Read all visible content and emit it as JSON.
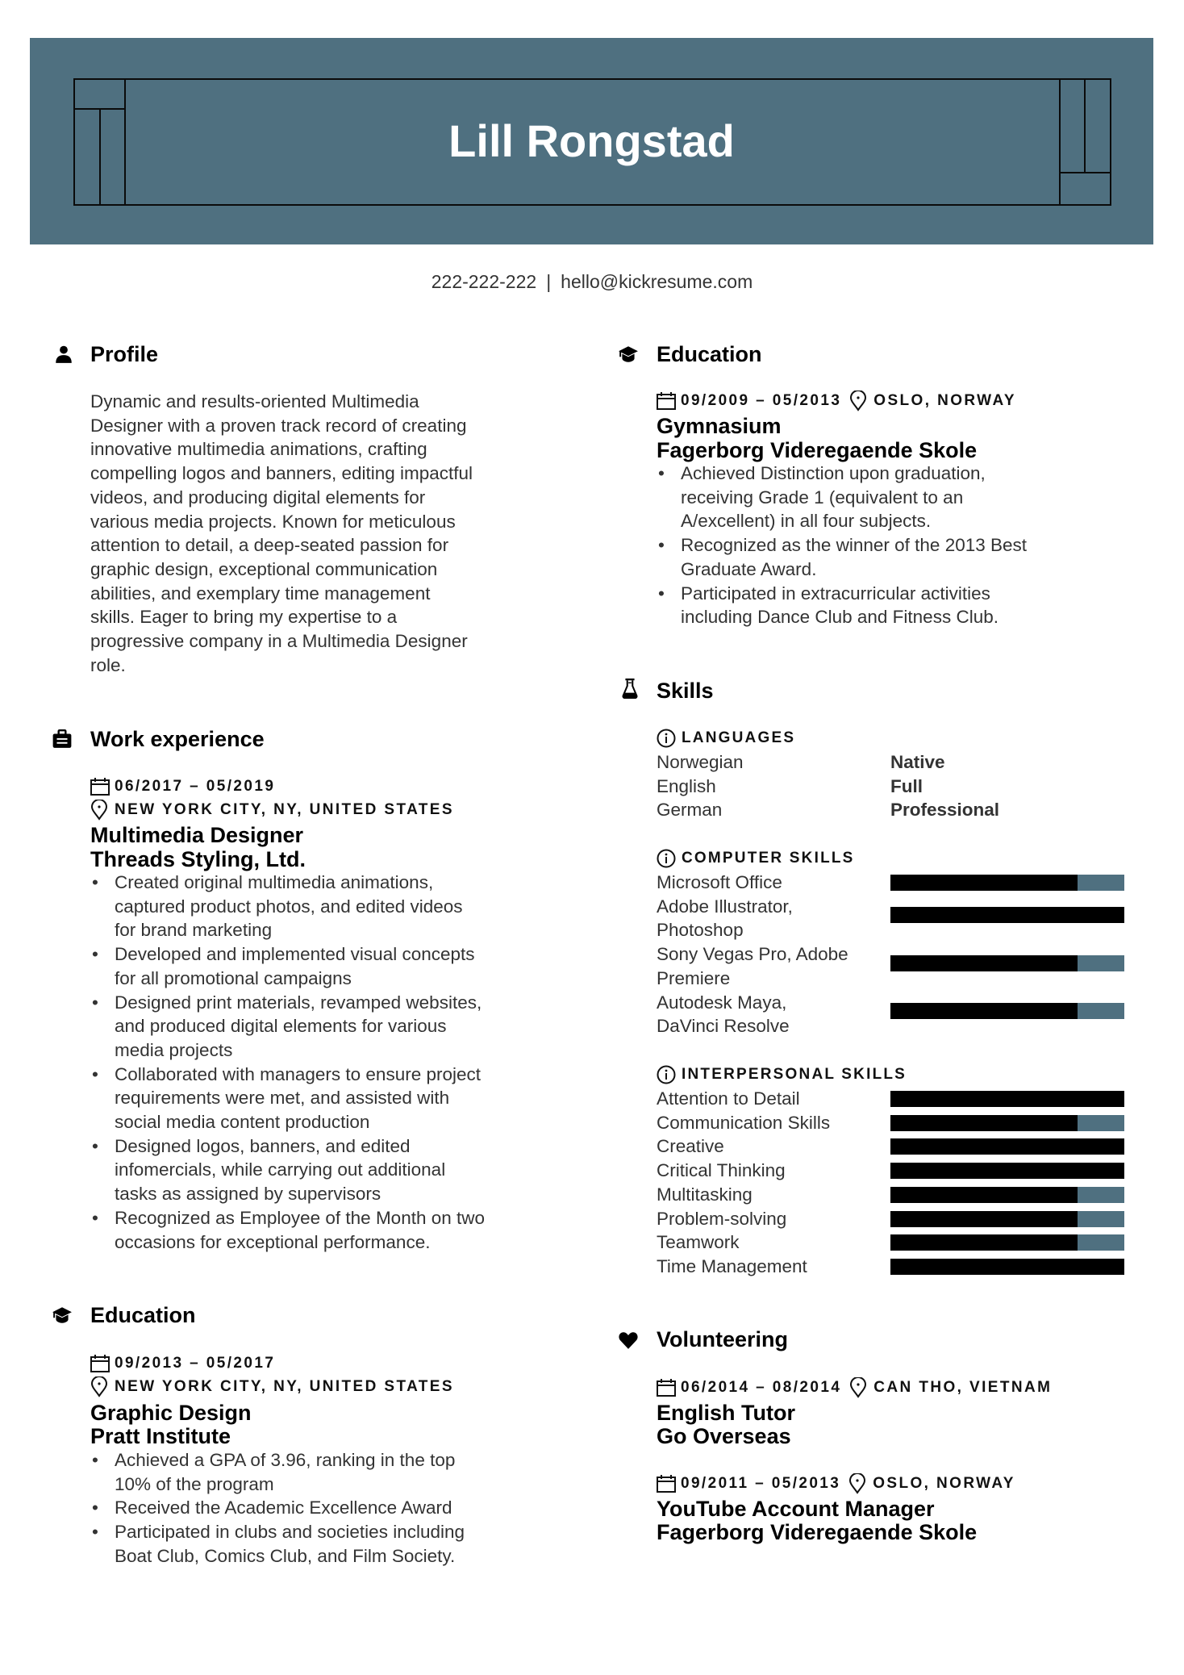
{
  "header": {
    "name": "Lill Rongstad",
    "accent_color": "#4f7080"
  },
  "contact": {
    "phone": "222-222-222",
    "separator": "|",
    "email": "hello@kickresume.com"
  },
  "profile": {
    "heading": "Profile",
    "icon": "user-icon",
    "lines": [
      "Dynamic and results-oriented Multimedia",
      "Designer with a proven track record of creating",
      "innovative multimedia animations, crafting",
      "compelling logos and banners, editing impactful",
      "videos, and producing digital elements for",
      "various media projects. Known for meticulous",
      "attention to detail, a deep-seated passion for",
      "graphic design, exceptional communication",
      "abilities, and exemplary time management",
      "skills. Eager to bring my expertise to a",
      "progressive company in a Multimedia Designer",
      "role."
    ]
  },
  "work": {
    "heading": "Work experience",
    "icon": "briefcase-icon",
    "entries": [
      {
        "dates": "06/2017 – 05/2019",
        "location": "NEW YORK CITY, NY, UNITED STATES",
        "title": "Multimedia Designer",
        "company": "Threads Styling, Ltd.",
        "bullets": [
          [
            "Created original multimedia animations,",
            "captured product photos, and edited videos",
            "for brand marketing"
          ],
          [
            "Developed and implemented visual concepts",
            "for all promotional campaigns"
          ],
          [
            "Designed print materials, revamped websites,",
            "and produced digital elements for various",
            "media projects"
          ],
          [
            "Collaborated with managers to ensure project",
            "requirements were met, and assisted with",
            "social media content production"
          ],
          [
            "Designed logos, banners, and edited",
            "infomercials, while carrying out additional",
            "tasks as assigned by supervisors"
          ],
          [
            "Recognized as Employee of the Month on two",
            "occasions for exceptional performance."
          ]
        ]
      }
    ]
  },
  "education_left": {
    "heading": "Education",
    "icon": "graduation-cap-icon",
    "entries": [
      {
        "dates": "09/2013 – 05/2017",
        "location": "NEW YORK CITY, NY, UNITED STATES",
        "degree": "Graphic Design",
        "school": "Pratt Institute",
        "bullets": [
          [
            "Achieved a GPA of 3.96, ranking in the top",
            "10% of the program"
          ],
          [
            "Received the Academic Excellence Award"
          ],
          [
            "Participated in clubs and societies including",
            "Boat Club, Comics Club, and Film Society."
          ]
        ]
      }
    ]
  },
  "education_right": {
    "heading": "Education",
    "icon": "graduation-cap-icon",
    "entries": [
      {
        "dates": "09/2009 – 05/2013",
        "location": "OSLO, NORWAY",
        "degree": "Gymnasium",
        "school": "Fagerborg Videregaende Skole",
        "bullets": [
          [
            "Achieved Distinction upon graduation,",
            "receiving Grade 1 (equivalent to an",
            "A/excellent) in all four subjects."
          ],
          [
            "Recognized as the winner of the 2013 Best",
            "Graduate Award."
          ],
          [
            "Participated in extracurricular activities",
            "including Dance Club and Fitness Club."
          ]
        ]
      }
    ]
  },
  "skills": {
    "heading": "Skills",
    "icon": "flask-icon",
    "languages": {
      "label": "LANGUAGES",
      "items": [
        {
          "name": "Norwegian",
          "level": "Native"
        },
        {
          "name": "English",
          "level": "Full"
        },
        {
          "name": "German",
          "level": "Professional"
        }
      ]
    },
    "computer": {
      "label": "COMPUTER SKILLS",
      "items": [
        {
          "name_lines": [
            "Microsoft Office"
          ],
          "level": 0.8
        },
        {
          "name_lines": [
            "Adobe Illustrator,",
            "Photoshop"
          ],
          "level": 1.0
        },
        {
          "name_lines": [
            "Sony Vegas Pro, Adobe",
            "Premiere"
          ],
          "level": 0.8
        },
        {
          "name_lines": [
            "Autodesk Maya,",
            "DaVinci Resolve"
          ],
          "level": 0.8
        }
      ]
    },
    "interpersonal": {
      "label": "INTERPERSONAL SKILLS",
      "items": [
        {
          "name": "Attention to Detail",
          "level": 1.0
        },
        {
          "name": "Communication Skills",
          "level": 0.8
        },
        {
          "name": "Creative",
          "level": 1.0
        },
        {
          "name": "Critical Thinking",
          "level": 1.0
        },
        {
          "name": "Multitasking",
          "level": 0.8
        },
        {
          "name": "Problem-solving",
          "level": 0.8
        },
        {
          "name": "Teamwork",
          "level": 0.8
        },
        {
          "name": "Time Management",
          "level": 1.0
        }
      ]
    }
  },
  "volunteering": {
    "heading": "Volunteering",
    "icon": "heart-icon",
    "entries": [
      {
        "dates": "06/2014 – 08/2014",
        "location": "CAN THO, VIETNAM",
        "title": "English Tutor",
        "org": "Go Overseas"
      },
      {
        "dates": "09/2011 – 05/2013",
        "location": "OSLO, NORWAY",
        "title": "YouTube Account Manager",
        "org": "Fagerborg Videregaende Skole"
      }
    ]
  }
}
